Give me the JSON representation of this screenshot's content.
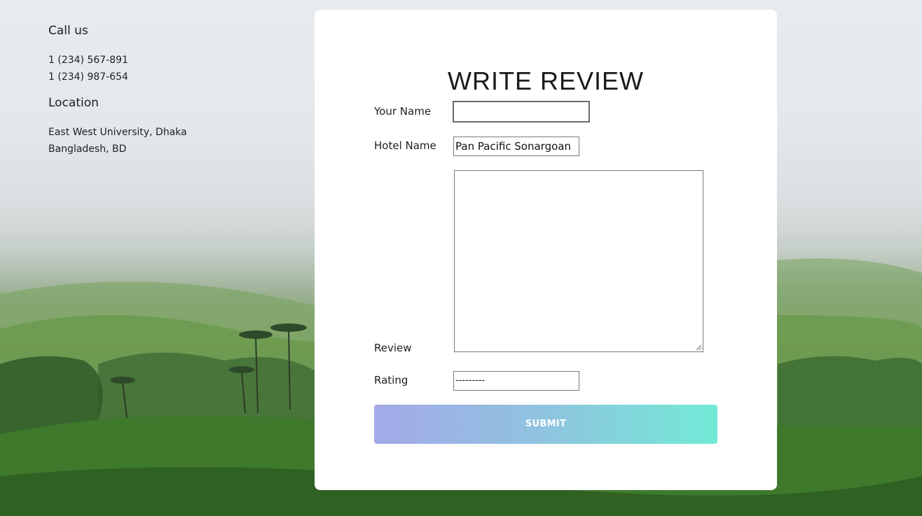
{
  "contact": {
    "call_heading": "Call us",
    "phones": [
      "1 (234) 567-891",
      "1 (234) 987-654"
    ],
    "location_heading": "Location",
    "address_lines": [
      "East West University, Dhaka",
      "Bangladesh, BD"
    ]
  },
  "form": {
    "title": "WRITE REVIEW",
    "name_label": "Your Name",
    "name_value": "",
    "hotel_label": "Hotel Name",
    "hotel_value": "Pan Pacific Sonargoan",
    "review_label": "Review",
    "review_value": "",
    "rating_label": "Rating",
    "rating_value": "---------",
    "submit_label": "SUBMIT"
  },
  "colors": {
    "submit_gradient_start": "#a3a9e8",
    "submit_gradient_end": "#72ead6",
    "card_background": "#ffffff"
  }
}
